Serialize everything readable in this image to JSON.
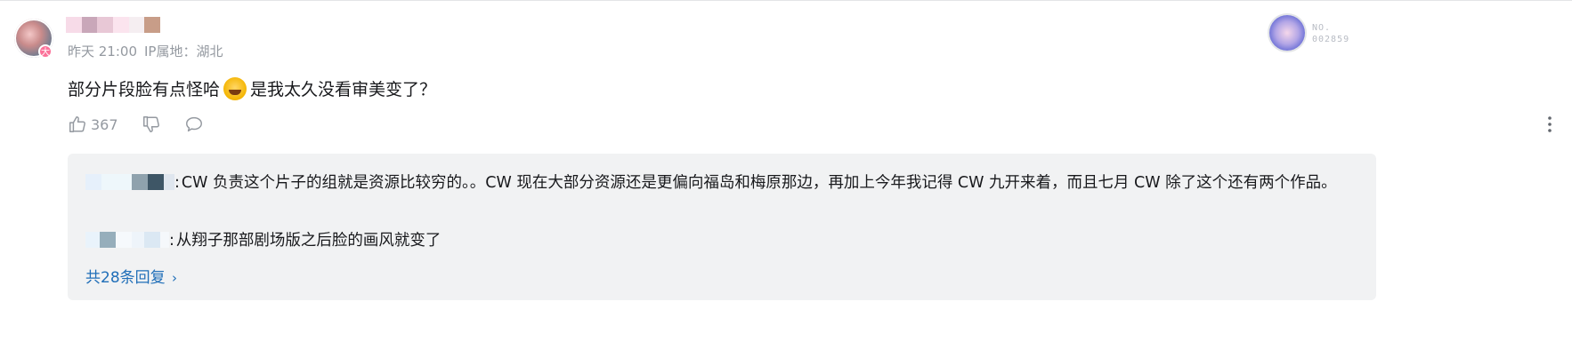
{
  "comment": {
    "timestamp": "昨天 21:00",
    "ip_location": "IP属地：湖北",
    "text_before_emoji": "部分片段脸有点怪哈",
    "emoji_icon": "laughing-crying-emoji",
    "text_after_emoji": "是我太久没看审美变了？",
    "like_count": "367",
    "medal": {
      "line1": "NO.",
      "line2": "002859"
    }
  },
  "replies": [
    {
      "text": "CW 负责这个片子的组就是资源比较穷的。。CW 现在大部分资源还是更偏向福岛和梅原那边，再加上今年我记得 CW 九开来着，而且七月 CW 除了这个还有两个作品。"
    },
    {
      "text": "从翔子那部剧场版之后脸的画风就变了"
    }
  ],
  "more_replies_label": "共28条回复",
  "more_replies_icon": "chevron-right-icon"
}
